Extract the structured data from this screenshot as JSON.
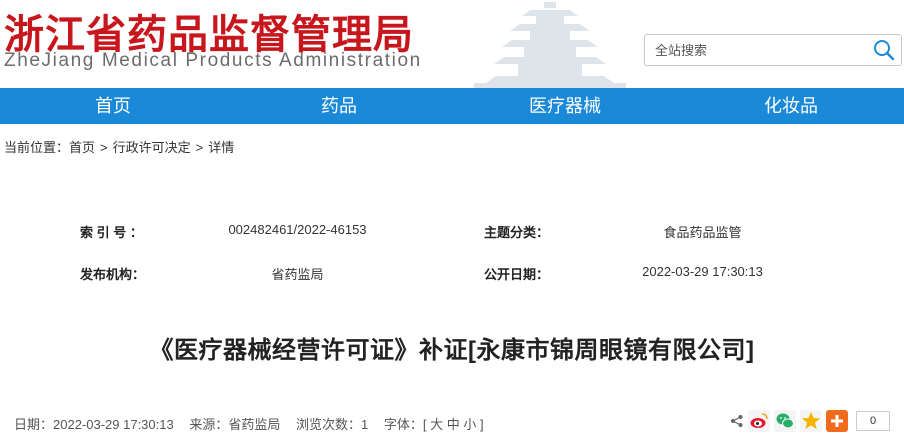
{
  "header": {
    "logo_cn": "浙江省药品监督管理局",
    "logo_en": "ZheJiang Medical Products Administration"
  },
  "search": {
    "placeholder": "全站搜索"
  },
  "nav": {
    "items": [
      "首页",
      "药品",
      "医疗器械",
      "化妆品"
    ]
  },
  "breadcrumb": {
    "prefix": "当前位置：",
    "items": [
      "首页",
      "行政许可决定",
      "详情"
    ],
    "separator": ">"
  },
  "meta": {
    "index_label": "索 引 号 ：",
    "index_value": "002482461/2022-46153",
    "topic_label": "主题分类：",
    "topic_value": "食品药品监管",
    "publisher_label": "发布机构：",
    "publisher_value": "省药监局",
    "date_label": "公开日期：",
    "date_value": "2022-03-29 17:30:13"
  },
  "article": {
    "title": "《医疗器械经营许可证》补证[永康市锦周眼镜有限公司]"
  },
  "info": {
    "date": "日期：2022-03-29 17:30:13",
    "source": "来源：省药监局",
    "views": "浏览次数：1",
    "font_prefix": "字体：[",
    "font_large": "大",
    "font_medium": "中",
    "font_small": "小",
    "font_suffix": "]"
  },
  "share": {
    "icons": [
      "share-icon",
      "weibo-icon",
      "wechat-icon",
      "qzone-icon",
      "more-icon"
    ],
    "count": "0"
  },
  "colors": {
    "logo_red": "#c8161d",
    "nav_blue": "#1a8ad8"
  }
}
